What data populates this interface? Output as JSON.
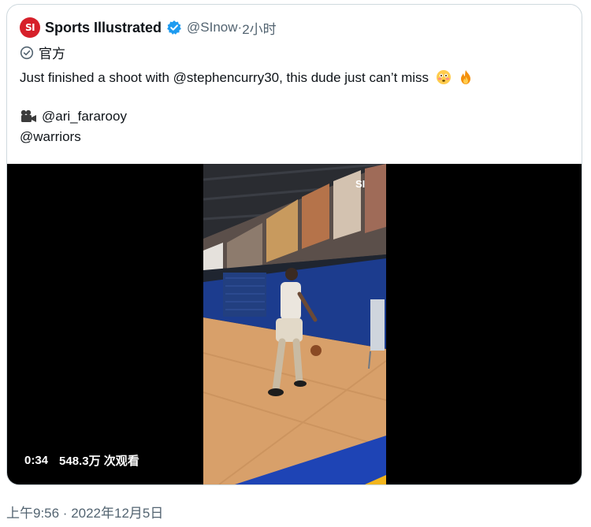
{
  "author": {
    "name": "Sports Illustrated",
    "avatar_text": "SI",
    "handle": "@SInow",
    "separator": " · ",
    "time_ago": "2小时",
    "verified_icon": "verified-badge-icon",
    "brand_color": "#d6202a",
    "verified_color": "#1d9bf0"
  },
  "label": {
    "icon": "official-check-icon",
    "text": "官方"
  },
  "tweet": {
    "text": "Just finished a shoot with @stephencurry30, this dude just can’t miss",
    "emoji_1": "flushed-face-icon",
    "emoji_2": "fire-icon",
    "credit_icon": "movie-camera-icon",
    "credit": "@ari_fararooy",
    "tag": "@warriors"
  },
  "video": {
    "duration": "0:34",
    "views": "548.3万 次观看",
    "watermark": "SI"
  },
  "footer": {
    "timestamp": "上午9:56 · 2022年12月5日"
  }
}
